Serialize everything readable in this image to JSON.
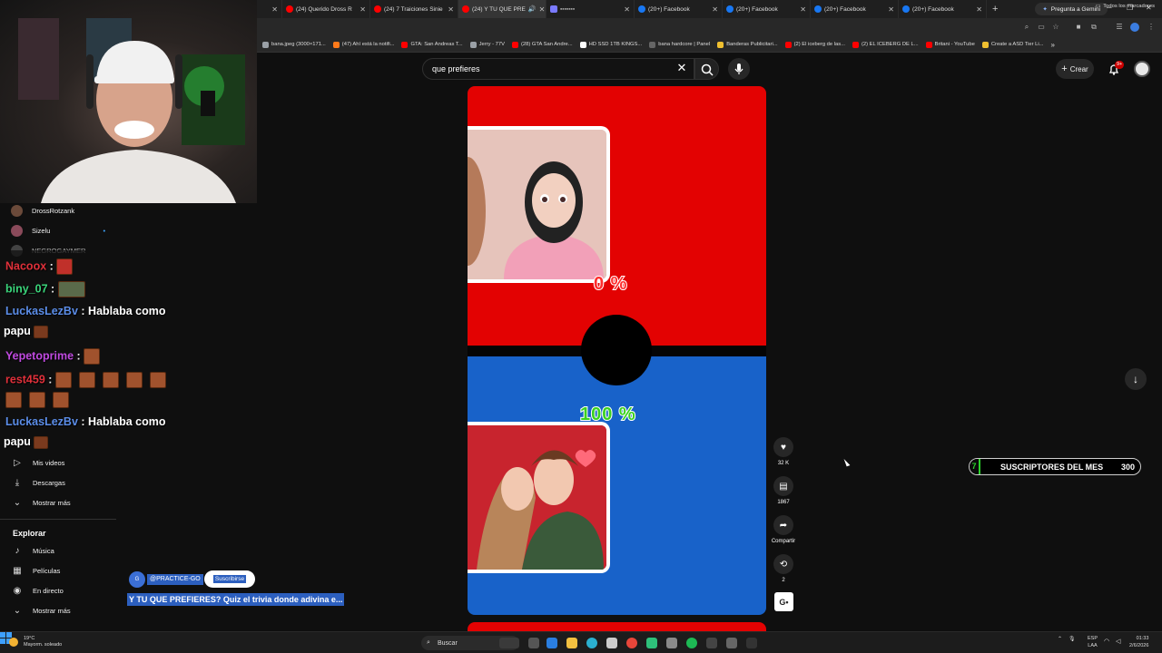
{
  "browser": {
    "tabs": [
      {
        "label": "(24) Querido Dross R",
        "color": "#ff0000",
        "active": false
      },
      {
        "label": "(24) 7 Traiciones Sinie",
        "color": "#ff0000",
        "active": false
      },
      {
        "label": "(24) Y TU QUE PRE",
        "color": "#ff0000",
        "active": true
      },
      {
        "label": "",
        "color": "#7a7aff",
        "active": false
      },
      {
        "label": "(20+) Facebook",
        "color": "#1877f2",
        "active": false
      },
      {
        "label": "(20+) Facebook",
        "color": "#1877f2",
        "active": false
      },
      {
        "label": "(20+) Facebook",
        "color": "#1877f2",
        "active": false
      },
      {
        "label": "(20+) Facebook",
        "color": "#1877f2",
        "active": false
      }
    ],
    "new_tab": "+",
    "gemini_label": "Pregunta a Gemini",
    "bookmarks": [
      {
        "label": "bana.jpeg (3000×171...",
        "color": "#9aa0a6"
      },
      {
        "label": "(47) Ahí está la notifi...",
        "color": "#ff7a1a"
      },
      {
        "label": "GTA: San Andreas T...",
        "color": "#ff0000"
      },
      {
        "label": "Jerry - 77V",
        "color": "#9aa0a6"
      },
      {
        "label": "(28) GTA San Andre...",
        "color": "#ff0000"
      },
      {
        "label": "HD SSD 1TB KINGS...",
        "color": "#ffffff"
      },
      {
        "label": "bana hardcore | Panel",
        "color": "#666666"
      },
      {
        "label": "Banderas Publicitari...",
        "color": "#f0c030"
      },
      {
        "label": "(2) El iceberg de las...",
        "color": "#ff0000"
      },
      {
        "label": "(2) EL ICEBERG DE L...",
        "color": "#ff0000"
      },
      {
        "label": "Britani - YouTube",
        "color": "#ff0000"
      },
      {
        "label": "Create a ASD Tier Li...",
        "color": "#f0c030"
      }
    ],
    "all_bookmarks": "Todos los marcadores"
  },
  "youtube": {
    "search_value": "que prefieres",
    "create_label": "Crear",
    "notif_count": "9+"
  },
  "sidebar": {
    "subscriptions": [
      {
        "label": "DrossRotzank"
      },
      {
        "label": "Sizelu",
        "dot": "•"
      },
      {
        "label": "NEGROGAYMER"
      }
    ],
    "you_items": [
      {
        "label": "Mis videos",
        "icon": "play-icon"
      },
      {
        "label": "Descargas",
        "icon": "download-icon"
      },
      {
        "label": "Mostrar más",
        "icon": "chevron-down-icon"
      }
    ],
    "explore_title": "Explorar",
    "explore_items": [
      {
        "label": "Música",
        "icon": "music-icon"
      },
      {
        "label": "Películas",
        "icon": "film-icon"
      },
      {
        "label": "En directo",
        "icon": "live-icon"
      },
      {
        "label": "Mostrar más",
        "icon": "chevron-down-icon"
      }
    ]
  },
  "chat": {
    "messages": [
      {
        "user": "Nacoox",
        "color": "#e0303a",
        "text": ""
      },
      {
        "user": "biny_07",
        "color": "#3ad47a",
        "text": ""
      },
      {
        "user": "LuckasLezBv",
        "color": "#5b8de8",
        "text": "Hablaba como"
      },
      {
        "user": "",
        "color": "#ffffff",
        "text": "papu"
      },
      {
        "user": "Yepetoprime",
        "color": "#c04ae0",
        "text": ""
      },
      {
        "user": "rest459",
        "color": "#e0303a",
        "text": ""
      },
      {
        "user": "LuckasLezBv",
        "color": "#5b8de8",
        "text": "Hablaba como"
      },
      {
        "user": "",
        "color": "#ffffff",
        "text": "papu"
      }
    ],
    "separator": ":"
  },
  "short": {
    "top_percent": "0 %",
    "bottom_percent": "100 %",
    "likes": "32 K",
    "comments": "1867",
    "share_label": "Compartir",
    "remix_count": "2",
    "channel_handle": "@PRACTICE-GO",
    "subscribe_label": "Suscribirse",
    "title": "Y TU QUE PREFIERES? Quiz el trivia donde adivina e..."
  },
  "widget": {
    "rank": "7",
    "label": "SUSCRIPTORES DEL MES",
    "count": "300"
  },
  "taskbar": {
    "temp": "19°C",
    "weather": "Mayorm. soleado",
    "search_label": "Buscar",
    "lang_top": "ESP",
    "lang_bottom": "LAA",
    "time": "01:33",
    "date": "2/6/2026"
  }
}
